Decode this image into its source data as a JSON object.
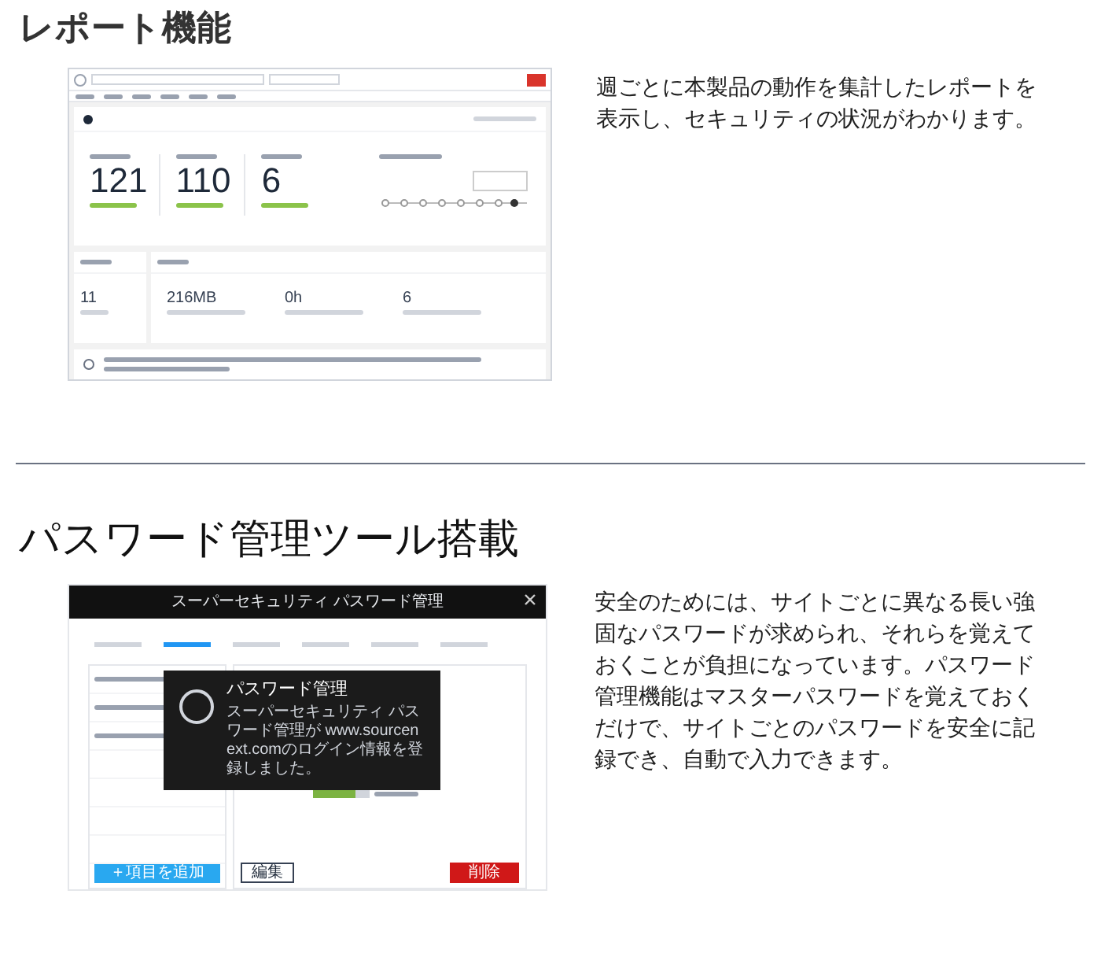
{
  "report_section": {
    "heading": "レポート機能",
    "description": "週ごとに本製品の動作を集計したレポートを表示し、セキュリティの状況がわかります。",
    "screenshot": {
      "top_stats": [
        {
          "value": "121"
        },
        {
          "value": "110"
        },
        {
          "value": "6"
        }
      ],
      "bottom_stats": [
        {
          "value": "11"
        },
        {
          "value": "216MB"
        },
        {
          "value": "0h"
        },
        {
          "value": "6"
        }
      ]
    }
  },
  "password_section": {
    "heading": "パスワード管理ツール搭載",
    "description": "安全のためには、サイトごとに異なる長い強固なパスワードが求められ、それらを覚えておくことが負担になっています。パスワード管理機能はマスターパスワードを覚えておくだけで、サイトごとのパスワードを安全に記録でき、自動で入力できます。",
    "screenshot": {
      "title": "スーパーセキュリティ パスワード管理",
      "tabs": [
        {
          "selected": false
        },
        {
          "selected": true
        },
        {
          "selected": false
        },
        {
          "selected": false
        },
        {
          "selected": false
        },
        {
          "selected": false
        }
      ],
      "dialog": {
        "title": "パスワード管理",
        "message": "スーパーセキュリティ パスワード管理が www.sourcenext.comのログイン情報を登録しました。"
      },
      "strength": {
        "level": 0.75
      },
      "add_button": "＋項目を追加",
      "edit_button": "編集",
      "delete_button": "削除"
    }
  }
}
